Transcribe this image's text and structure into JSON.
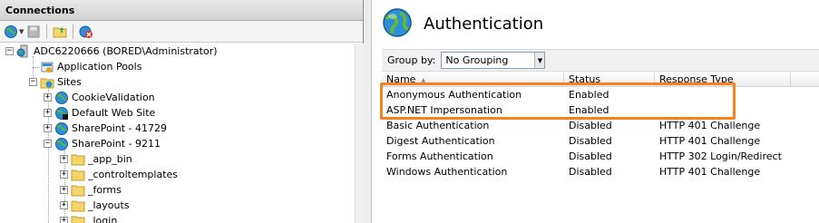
{
  "connections": {
    "title": "Connections",
    "tree": {
      "server": "ADC6220666 (BORED\\Administrator)",
      "app_pools": "Application Pools",
      "sites": "Sites",
      "site_items": [
        "CookieValidation",
        "Default Web Site",
        "SharePoint - 41729",
        "SharePoint - 9211"
      ],
      "folders": [
        "_app_bin",
        "_controltemplates",
        "_forms",
        "_layouts",
        "_login"
      ]
    }
  },
  "feature": {
    "title": "Authentication",
    "group_by_label": "Group by:",
    "group_by_value": "No Grouping",
    "columns": {
      "name": "Name",
      "status": "Status",
      "response_type": "Response Type"
    },
    "rows": [
      {
        "name": "Anonymous Authentication",
        "status": "Enabled",
        "response_type": ""
      },
      {
        "name": "ASP.NET Impersonation",
        "status": "Enabled",
        "response_type": ""
      },
      {
        "name": "Basic Authentication",
        "status": "Disabled",
        "response_type": "HTTP 401 Challenge"
      },
      {
        "name": "Digest Authentication",
        "status": "Disabled",
        "response_type": "HTTP 401 Challenge"
      },
      {
        "name": "Forms Authentication",
        "status": "Disabled",
        "response_type": "HTTP 302 Login/Redirect"
      },
      {
        "name": "Windows Authentication",
        "status": "Disabled",
        "response_type": "HTTP 401 Challenge"
      }
    ]
  },
  "colors": {
    "highlight": "#f7821b",
    "folder": "#f3d56b",
    "globe": "#2a8fd6"
  }
}
